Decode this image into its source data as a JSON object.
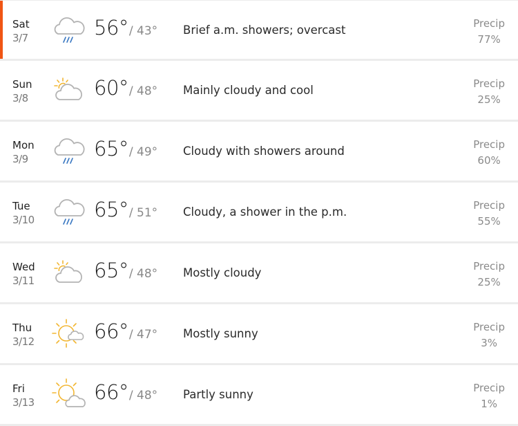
{
  "accent_color": "#f05514",
  "forecast": [
    {
      "dow": "Sat",
      "date": "3/7",
      "icon": "rain-cloud-icon",
      "hi": "56°",
      "lo": "/ 43°",
      "desc": "Brief a.m. showers; overcast",
      "precip_label": "Precip",
      "precip": "77%",
      "active": true
    },
    {
      "dow": "Sun",
      "date": "3/8",
      "icon": "mostly-cloudy-icon",
      "hi": "60°",
      "lo": "/ 48°",
      "desc": "Mainly cloudy and cool",
      "precip_label": "Precip",
      "precip": "25%"
    },
    {
      "dow": "Mon",
      "date": "3/9",
      "icon": "rain-cloud-icon",
      "hi": "65°",
      "lo": "/ 49°",
      "desc": "Cloudy with showers around",
      "precip_label": "Precip",
      "precip": "60%"
    },
    {
      "dow": "Tue",
      "date": "3/10",
      "icon": "rain-cloud-icon",
      "hi": "65°",
      "lo": "/ 51°",
      "desc": "Cloudy, a shower in the p.m.",
      "precip_label": "Precip",
      "precip": "55%"
    },
    {
      "dow": "Wed",
      "date": "3/11",
      "icon": "mostly-cloudy-icon",
      "hi": "65°",
      "lo": "/ 48°",
      "desc": "Mostly cloudy",
      "precip_label": "Precip",
      "precip": "25%"
    },
    {
      "dow": "Thu",
      "date": "3/12",
      "icon": "mostly-sunny-icon",
      "hi": "66°",
      "lo": "/ 47°",
      "desc": "Mostly sunny",
      "precip_label": "Precip",
      "precip": "3%"
    },
    {
      "dow": "Fri",
      "date": "3/13",
      "icon": "partly-sunny-icon",
      "hi": "66°",
      "lo": "/ 48°",
      "desc": "Partly sunny",
      "precip_label": "Precip",
      "precip": "1%"
    }
  ]
}
